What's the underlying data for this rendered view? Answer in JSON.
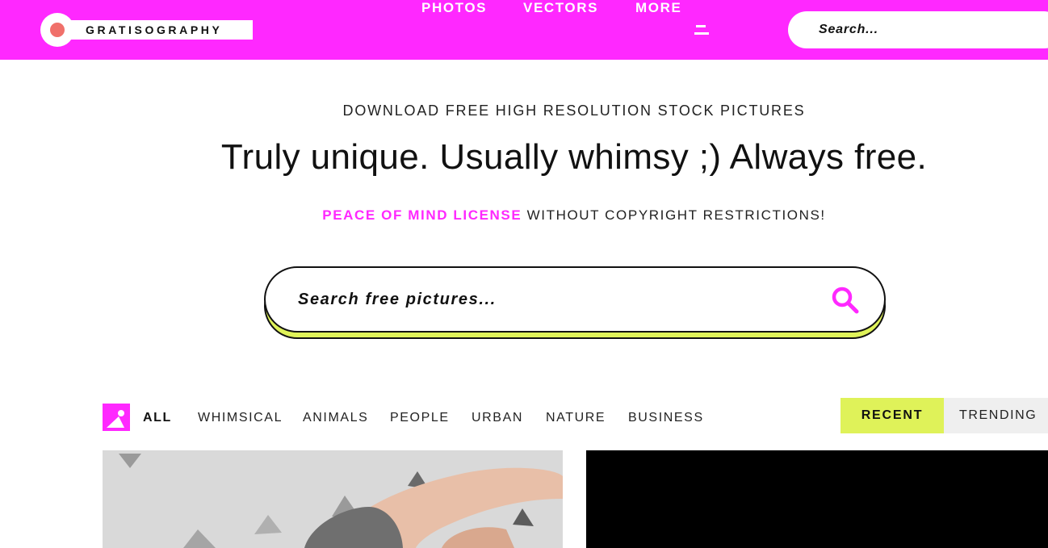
{
  "colors": {
    "brand_pink": "#ff28ff",
    "accent_lime": "#dff259",
    "logo_dot": "#f0706a",
    "text_dark": "#111111"
  },
  "header": {
    "logo_text": "GRATISOGRAPHY",
    "nav": {
      "photos": "PHOTOS",
      "vectors": "VECTORS",
      "more": "MORE"
    },
    "search_placeholder": "Search..."
  },
  "hero": {
    "tagline": "DOWNLOAD FREE HIGH RESOLUTION STOCK PICTURES",
    "headline": "Truly unique. Usually whimsy ;) Always free.",
    "license_link": "PEACE OF MIND LICENSE",
    "license_rest": " WITHOUT COPYRIGHT RESTRICTIONS!",
    "search_placeholder": "Search free pictures..."
  },
  "filters": {
    "categories": [
      "ALL",
      "WHIMSICAL",
      "ANIMALS",
      "PEOPLE",
      "URBAN",
      "NATURE",
      "BUSINESS"
    ],
    "sort": {
      "recent": "RECENT",
      "trending": "TRENDING",
      "selected": "RECENT"
    }
  },
  "icons": {
    "menu": "hamburger-icon",
    "search": "magnifier-icon",
    "all": "image-icon"
  }
}
